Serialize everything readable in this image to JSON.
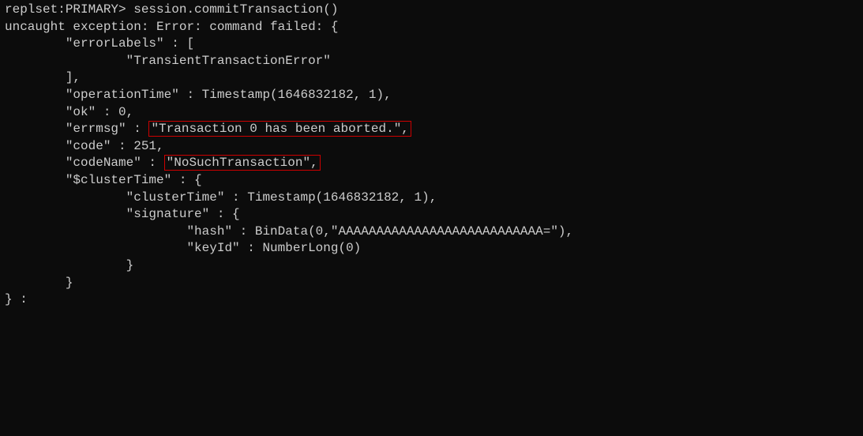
{
  "colors": {
    "background": "#0c0c0c",
    "foreground": "#cccccc",
    "highlight": "#cc0000"
  },
  "terminal": {
    "line0": "replset:PRIMARY> session.commitTransaction()",
    "line1": "uncaught exception: Error: command failed: {",
    "line2": "        \"errorLabels\" : [",
    "line3": "                \"TransientTransactionError\"",
    "line4": "        ],",
    "line5": "        \"operationTime\" : Timestamp(1646832182, 1),",
    "line6": "        \"ok\" : 0,",
    "line7_a": "        \"errmsg\" : ",
    "line7_b": "\"Transaction 0 has been aborted.\",",
    "line8": "        \"code\" : 251,",
    "line9_a": "        \"codeName\" : ",
    "line9_b": "\"NoSuchTransaction\",",
    "line10": "        \"$clusterTime\" : {",
    "line11": "                \"clusterTime\" : Timestamp(1646832182, 1),",
    "line12": "                \"signature\" : {",
    "line13": "                        \"hash\" : BinData(0,\"AAAAAAAAAAAAAAAAAAAAAAAAAAA=\"),",
    "line14": "                        \"keyId\" : NumberLong(0)",
    "line15": "                }",
    "line16": "        }",
    "line17": "} :"
  }
}
